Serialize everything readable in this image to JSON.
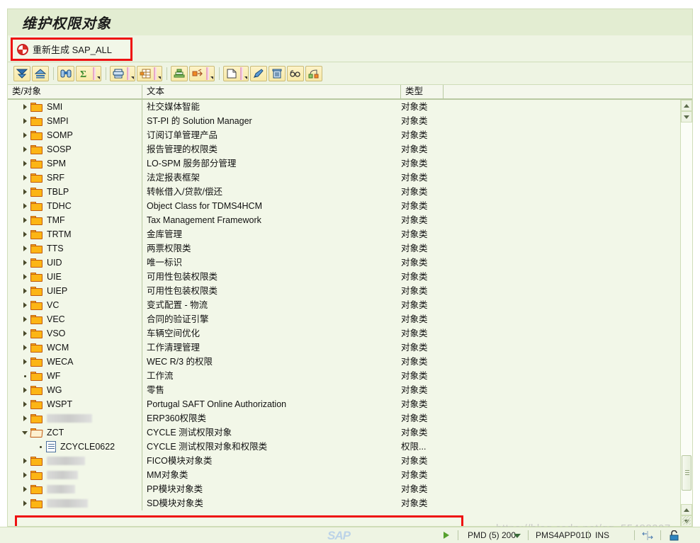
{
  "window": {
    "title": "维护权限对象"
  },
  "action_bar": {
    "regen_label": "重新生成 SAP_ALL",
    "regen_icon": "regenerate-icon",
    "highlight_color": "#ee1111"
  },
  "toolbar": {
    "buttons": [
      {
        "name": "filter-button",
        "icon": "filter-icon",
        "tip": "过滤"
      },
      {
        "name": "sort-ascending-button",
        "icon": "sort-ascending-icon",
        "tip": "升序"
      },
      {
        "name": "find-button",
        "icon": "binoculars-icon",
        "tip": "查找"
      },
      {
        "name": "total-button",
        "icon": "sigma-icon",
        "tip": "总计"
      },
      {
        "name": "print-button",
        "icon": "printer-icon",
        "tip": "打印"
      },
      {
        "name": "layout-button",
        "icon": "table-layout-icon",
        "tip": "布局"
      },
      {
        "name": "subtotal-button",
        "icon": "stack-icon",
        "tip": "小计"
      },
      {
        "name": "export-button",
        "icon": "export-arrows-icon",
        "tip": "导出"
      },
      {
        "name": "new-button",
        "icon": "new-document-icon",
        "tip": "新建"
      },
      {
        "name": "edit-button",
        "icon": "pencil-icon",
        "tip": "修改"
      },
      {
        "name": "delete-button",
        "icon": "trash-icon",
        "tip": "删除"
      },
      {
        "name": "display-button",
        "icon": "glasses-icon",
        "tip": "显示"
      },
      {
        "name": "transport-button",
        "icon": "transport-icon",
        "tip": "传输"
      }
    ]
  },
  "grid": {
    "columns": [
      "类/对象",
      "文本",
      "类型",
      ""
    ],
    "rows": [
      {
        "name": "SMI",
        "text": "社交媒体智能",
        "type": "对象类",
        "icon": "folder",
        "expander": "triangle",
        "level": 0
      },
      {
        "name": "SMPI",
        "text": "ST-PI 的 Solution Manager",
        "type": "对象类",
        "icon": "folder",
        "expander": "triangle",
        "level": 0
      },
      {
        "name": "SOMP",
        "text": "订阅订单管理产品",
        "type": "对象类",
        "icon": "folder",
        "expander": "triangle",
        "level": 0
      },
      {
        "name": "SOSP",
        "text": "报告管理的权限类",
        "type": "对象类",
        "icon": "folder",
        "expander": "triangle",
        "level": 0
      },
      {
        "name": "SPM",
        "text": "LO-SPM 服务部分管理",
        "type": "对象类",
        "icon": "folder",
        "expander": "triangle",
        "level": 0
      },
      {
        "name": "SRF",
        "text": "法定报表框架",
        "type": "对象类",
        "icon": "folder",
        "expander": "triangle",
        "level": 0
      },
      {
        "name": "TBLP",
        "text": "转帐借入/贷款/偿还",
        "type": "对象类",
        "icon": "folder",
        "expander": "triangle",
        "level": 0
      },
      {
        "name": "TDHC",
        "text": "Object Class for TDMS4HCM",
        "type": "对象类",
        "icon": "folder",
        "expander": "triangle",
        "level": 0
      },
      {
        "name": "TMF",
        "text": "Tax Management Framework",
        "type": "对象类",
        "icon": "folder",
        "expander": "triangle",
        "level": 0
      },
      {
        "name": "TRTM",
        "text": "金库管理",
        "type": "对象类",
        "icon": "folder",
        "expander": "triangle",
        "level": 0
      },
      {
        "name": "TTS",
        "text": "两票权限类",
        "type": "对象类",
        "icon": "folder",
        "expander": "triangle",
        "level": 0
      },
      {
        "name": "UID",
        "text": "唯一标识",
        "type": "对象类",
        "icon": "folder",
        "expander": "triangle",
        "level": 0
      },
      {
        "name": "UIE",
        "text": "可用性包装权限类",
        "type": "对象类",
        "icon": "folder",
        "expander": "triangle",
        "level": 0
      },
      {
        "name": "UIEP",
        "text": "可用性包装权限类",
        "type": "对象类",
        "icon": "folder",
        "expander": "triangle",
        "level": 0
      },
      {
        "name": "VC",
        "text": "变式配置 - 物流",
        "type": "对象类",
        "icon": "folder",
        "expander": "triangle",
        "level": 0
      },
      {
        "name": "VEC",
        "text": "合同的验证引擎",
        "type": "对象类",
        "icon": "folder",
        "expander": "triangle",
        "level": 0
      },
      {
        "name": "VSO",
        "text": "车辆空间优化",
        "type": "对象类",
        "icon": "folder",
        "expander": "triangle",
        "level": 0
      },
      {
        "name": "WCM",
        "text": "工作清理管理",
        "type": "对象类",
        "icon": "folder",
        "expander": "triangle",
        "level": 0
      },
      {
        "name": "WECA",
        "text": "WEC R/3 的权限",
        "type": "对象类",
        "icon": "folder",
        "expander": "triangle",
        "level": 0
      },
      {
        "name": "WF",
        "text": "工作流",
        "type": "对象类",
        "icon": "folder",
        "expander": "dot",
        "level": 0
      },
      {
        "name": "WG",
        "text": "零售",
        "type": "对象类",
        "icon": "folder",
        "expander": "triangle",
        "level": 0
      },
      {
        "name": "WSPT",
        "text": "Portugal SAFT Online Authorization",
        "type": "对象类",
        "icon": "folder",
        "expander": "triangle",
        "level": 0
      },
      {
        "name": "",
        "redacted": 64,
        "text": "ERP360权限类",
        "type": "对象类",
        "icon": "folder",
        "expander": "triangle",
        "level": 0
      },
      {
        "name": "ZCT",
        "text": "CYCLE 测试权限对象",
        "type": "对象类",
        "icon": "folder-open",
        "expander": "triangle-down",
        "level": 0,
        "highlight": true
      },
      {
        "name": "ZCYCLE0622",
        "text": "CYCLE 测试权限对象和权限类",
        "type": "权限...",
        "icon": "document",
        "expander": "dot",
        "level": 1,
        "highlight": true
      },
      {
        "name": "",
        "redacted": 54,
        "text": "FICO模块对象类",
        "type": "对象类",
        "icon": "folder",
        "expander": "triangle",
        "level": 0
      },
      {
        "name": "",
        "redacted": 44,
        "text": "MM对象类",
        "type": "对象类",
        "icon": "folder",
        "expander": "triangle",
        "level": 0
      },
      {
        "name": "",
        "redacted": 40,
        "text": "PP模块对象类",
        "type": "对象类",
        "icon": "folder",
        "expander": "triangle",
        "level": 0
      },
      {
        "name": "",
        "redacted": 58,
        "text": "SD模块对象类",
        "type": "对象类",
        "icon": "folder",
        "expander": "triangle",
        "level": 0
      }
    ]
  },
  "scrollbar": {
    "up_arrow": "scroll-up-icon",
    "down_arrow": "scroll-down-icon"
  },
  "status_bar": {
    "logo": "SAP",
    "ready_icon": "green-play-icon",
    "system": "PMD (5) 200",
    "server": "PMS4APP01D",
    "insert_mode": "INS",
    "resize_icon": "resize-icon",
    "lock_icon": "unlock-icon"
  },
  "watermark": {
    "text": "https://blog.csdn.net/qq_55488207"
  }
}
